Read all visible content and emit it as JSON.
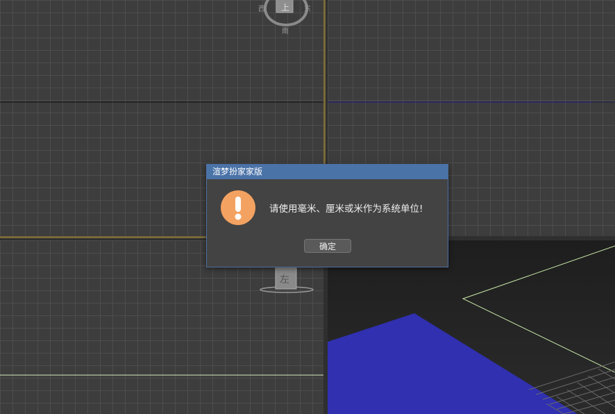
{
  "viewports": {
    "top": {
      "viewcube": {
        "face": "上",
        "north_hidden": "",
        "west": "西",
        "east": "东",
        "south": "南"
      }
    },
    "left": {
      "viewcube": {
        "face": "左"
      }
    }
  },
  "dialog": {
    "title": "渲梦扮家家版",
    "icon": "warning-exclamation-icon",
    "message": "请使用毫米、厘米或米作为系统单位!",
    "ok_label": "确定"
  },
  "colors": {
    "dialog_title_bar": "#4a73a8",
    "warning_icon": "#f4a261",
    "perspective_plane": "#3030b0",
    "active_viewport_border": "#7a6a3a"
  }
}
